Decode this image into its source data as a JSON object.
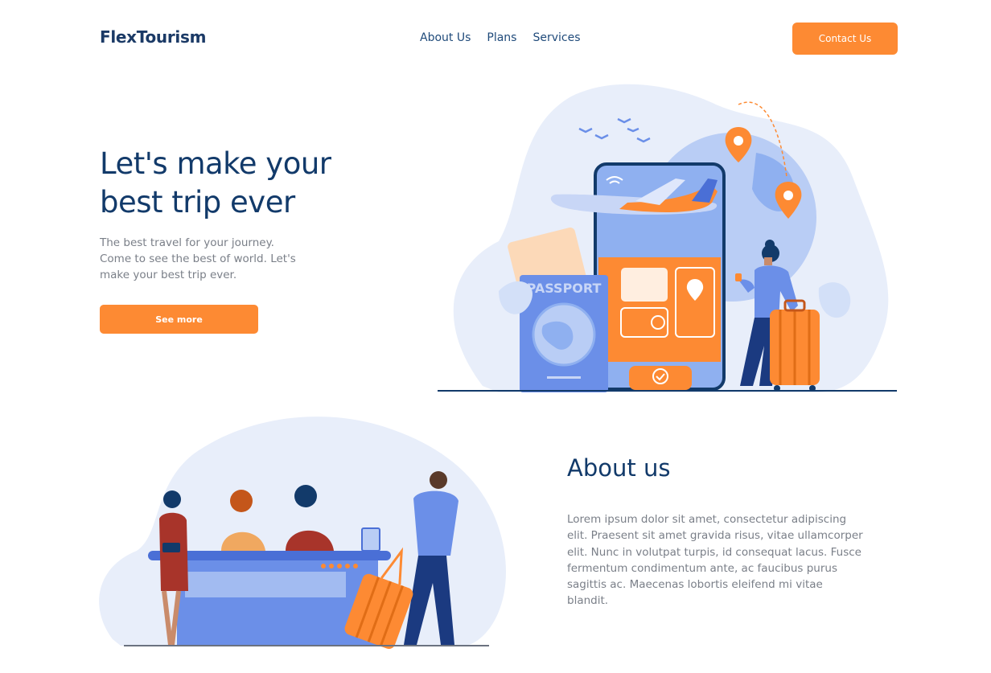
{
  "header": {
    "logo": "FlexTourism",
    "nav": [
      "About Us",
      "Plans",
      "Services"
    ],
    "contact_label": "Contact Us"
  },
  "hero": {
    "title_line1": "Let's make your",
    "title_line2": "best trip ever",
    "description": "The best travel for your journey. Come to see the best of world. Let's make your best trip ever.",
    "cta_label": "See more",
    "illustration": {
      "passport_label": "PASSPORT"
    }
  },
  "about": {
    "title": "About us",
    "text": "Lorem ipsum dolor sit amet, consectetur adipiscing elit. Praesent sit amet gravida risus, vitae ullamcorper elit. Nunc in volutpat turpis, id consequat lacus. Fusce fermentum condimentum ante, ac faucibus purus sagittis ac. Maecenas lobortis eleifend mi vitae blandit."
  },
  "colors": {
    "accent": "#fd8a33",
    "navy": "#123a6a",
    "blob": "#e8eefa",
    "blue": "#6b8fe8",
    "text_gray": "#7a7f88"
  },
  "icons": [
    "wifi-icon",
    "location-pin-icon",
    "plane-icon",
    "clock-icon",
    "check-icon",
    "globe-icon",
    "star-icon"
  ]
}
